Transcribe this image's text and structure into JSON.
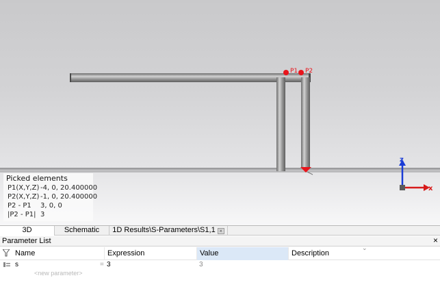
{
  "viewport": {
    "ports": [
      {
        "label": "P1"
      },
      {
        "label": "P2"
      }
    ],
    "picked": {
      "title": "Picked elements",
      "rows": [
        {
          "key": "P1(X,Y,Z)",
          "value": "-4, 0, 20.400000"
        },
        {
          "key": "P2(X,Y,Z)",
          "value": "-1, 0, 20.400000"
        },
        {
          "key": "P2 - P1",
          "value": "3, 0, 0"
        },
        {
          "key": "|P2 - P1|",
          "value": "3"
        }
      ]
    },
    "axes": {
      "z": "z",
      "x": "x"
    },
    "colors": {
      "port": "#e8141b",
      "z_axis": "#1a3cd6",
      "x_axis": "#d71a1a"
    }
  },
  "tabs": [
    {
      "label": "3D",
      "active": true
    },
    {
      "label": "Schematic",
      "active": false
    },
    {
      "label": "1D Results\\S-Parameters\\S1,1",
      "active": false
    }
  ],
  "parameter_list": {
    "title": "Parameter List",
    "close": "×",
    "columns": [
      "Name",
      "Expression",
      "Value",
      "Description"
    ],
    "rows": [
      {
        "name": "s",
        "eq": "=",
        "expression": "3",
        "value": "3",
        "description": ""
      }
    ],
    "new_placeholder": "<new parameter>"
  }
}
